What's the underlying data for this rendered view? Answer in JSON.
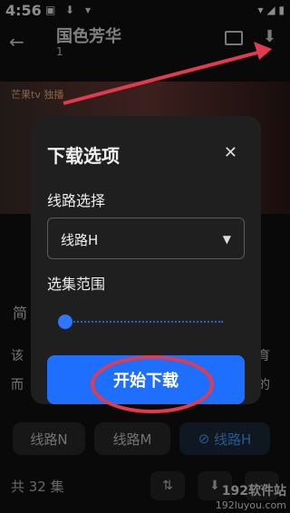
{
  "status": {
    "time": "4:56"
  },
  "header": {
    "back": "←",
    "title": "国色芳华",
    "subtitle": "1"
  },
  "video": {
    "logo": "芒果tv 独播"
  },
  "background": {
    "section_heading": "简",
    "text_line1": "该",
    "text_line2": "而",
    "right_line1": "育",
    "right_line2": "的",
    "chips": [
      "线路N",
      "线路M",
      "线路H"
    ],
    "chip_selected": "线路H",
    "episode_count": "共 32 集",
    "watermark_line1": "192软件站",
    "watermark_line2": "192luyou.com"
  },
  "dialog": {
    "title": "下载选项",
    "close": "✕",
    "route_label": "线路选择",
    "route_value": "线路H",
    "range_label": "选集范围",
    "start_button": "开始下载"
  },
  "colors": {
    "accent": "#1f6fff",
    "annotation": "#e23a4e"
  }
}
